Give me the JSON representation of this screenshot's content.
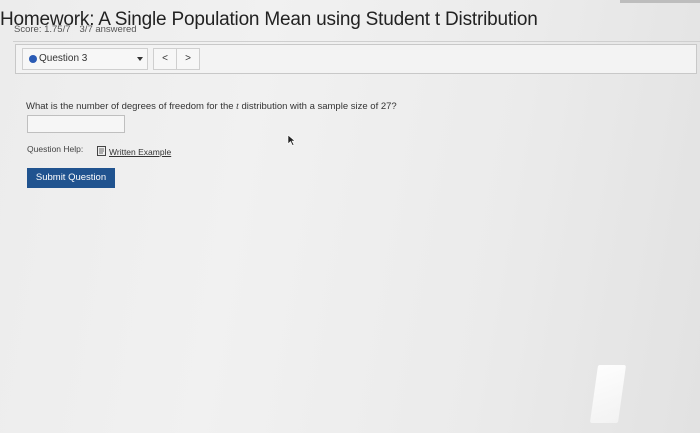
{
  "header": {
    "title": "Homework: A Single Population Mean using Student t Distribution",
    "score": "Score: 1.75/7",
    "answered": "3/7 answered"
  },
  "question_nav": {
    "selected_question": "Question 3",
    "prev_glyph": "<",
    "next_glyph": ">"
  },
  "question": {
    "text_before": "What is the number of degrees of freedom for the ",
    "text_italic": "t",
    "text_after": " distribution with a sample size of 27?",
    "answer_value": ""
  },
  "help": {
    "label": "Question Help:",
    "link_label": "Written Example",
    "link_icon": "document-icon"
  },
  "submit_label": "Submit Question",
  "colors": {
    "accent": "#20538f",
    "status_dot": "#2a5bb5"
  }
}
